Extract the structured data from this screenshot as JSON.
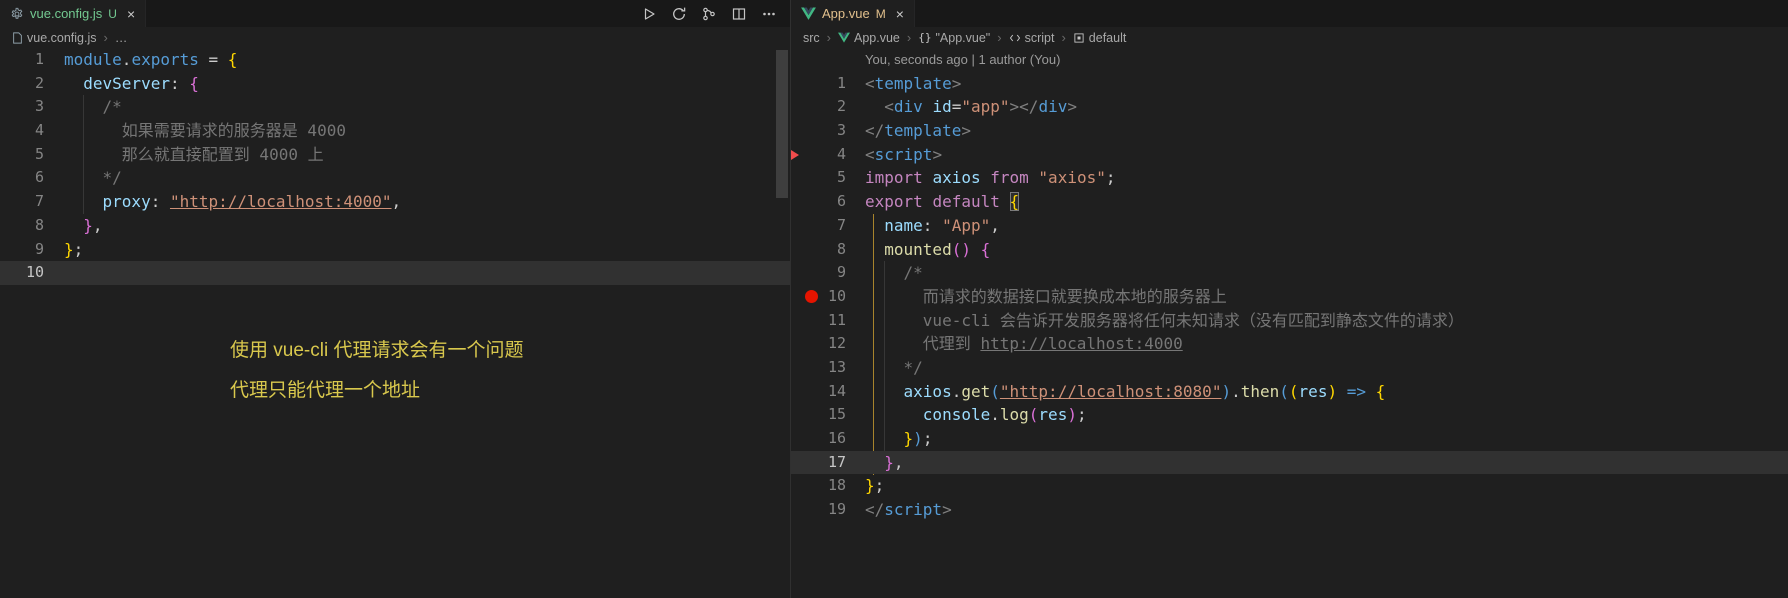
{
  "colors": {
    "editor_bg": "#1f1f1f",
    "tabbar_bg": "#181818",
    "untracked_green": "#73c991",
    "modified_yellow": "#e2c08d",
    "breakpoint_red": "#e51400",
    "annotation_yellow": "#d9c84d",
    "bracket_guide_gold": "#a8842c",
    "string_orange": "#ce9178",
    "keyword_blue": "#569cd6",
    "keyword_pink": "#c586c0"
  },
  "left_pane": {
    "tab": {
      "label": "vue.config.js",
      "git_badge": "U",
      "close_label": "×"
    },
    "toolbar": {
      "icons": [
        "run",
        "refresh",
        "source-control-graph",
        "split-editor",
        "more-actions"
      ]
    },
    "breadcrumb": {
      "sep": "›",
      "items": [
        "vue.config.js",
        "…"
      ]
    },
    "annotations": [
      "使用 vue-cli 代理请求会有一个问题",
      "代理只能代理一个地址"
    ],
    "code": [
      {
        "n": "1",
        "t": [
          [
            "module",
            "c-blue"
          ],
          [
            ".",
            "c-pun"
          ],
          [
            "exports",
            "c-blue"
          ],
          [
            " = ",
            "c-pun"
          ],
          [
            "{",
            "c-gold"
          ]
        ]
      },
      {
        "n": "2",
        "t": [
          [
            "  ",
            "c-pun"
          ],
          [
            "devServer",
            "c-lblue"
          ],
          [
            ": ",
            "c-pun"
          ],
          [
            "{",
            "c-purp"
          ]
        ]
      },
      {
        "n": "3",
        "t": [
          [
            "    /*",
            "c-cmt"
          ]
        ]
      },
      {
        "n": "4",
        "t": [
          [
            "      如果需要请求的服务器是 4000",
            "c-cmt"
          ]
        ]
      },
      {
        "n": "5",
        "t": [
          [
            "      那么就直接配置到 4000 上",
            "c-cmt"
          ]
        ]
      },
      {
        "n": "6",
        "t": [
          [
            "    */",
            "c-cmt"
          ]
        ]
      },
      {
        "n": "7",
        "t": [
          [
            "    ",
            "c-pun"
          ],
          [
            "proxy",
            "c-lblue"
          ],
          [
            ": ",
            "c-pun"
          ],
          [
            "\"http://localhost:4000\"",
            "c-str u"
          ],
          [
            ",",
            "c-pun"
          ]
        ]
      },
      {
        "n": "8",
        "t": [
          [
            "  ",
            "c-pun"
          ],
          [
            "}",
            "c-purp"
          ],
          [
            ",",
            "c-pun"
          ]
        ]
      },
      {
        "n": "9",
        "t": [
          [
            "}",
            "c-gold"
          ],
          [
            ";",
            "c-pun"
          ]
        ]
      },
      {
        "n": "10",
        "t": [],
        "hl": true
      }
    ]
  },
  "right_pane": {
    "tab": {
      "label": "App.vue",
      "git_badge": "M",
      "close_label": "×"
    },
    "breadcrumb": {
      "sep": "›",
      "braces": "{}",
      "items": [
        "src",
        "App.vue",
        "\"App.vue\"",
        "script",
        "default"
      ]
    },
    "codelens": "You, seconds ago | 1 author (You)",
    "code": [
      {
        "n": "1",
        "t": [
          [
            "<",
            "c-ang"
          ],
          [
            "template",
            "c-blue"
          ],
          [
            ">",
            "c-ang"
          ]
        ]
      },
      {
        "n": "2",
        "t": [
          [
            "  ",
            "c-pun"
          ],
          [
            "<",
            "c-ang"
          ],
          [
            "div",
            "c-blue"
          ],
          [
            " ",
            "c-pun"
          ],
          [
            "id",
            "c-lblue"
          ],
          [
            "=",
            "c-pun"
          ],
          [
            "\"app\"",
            "c-str"
          ],
          [
            ">",
            "c-ang"
          ],
          [
            "</",
            "c-ang"
          ],
          [
            "div",
            "c-blue"
          ],
          [
            ">",
            "c-ang"
          ]
        ]
      },
      {
        "n": "3",
        "t": [
          [
            "</",
            "c-ang"
          ],
          [
            "template",
            "c-blue"
          ],
          [
            ">",
            "c-ang"
          ]
        ]
      },
      {
        "n": "4",
        "t": [
          [
            "<",
            "c-ang"
          ],
          [
            "script",
            "c-blue"
          ],
          [
            ">",
            "c-ang"
          ]
        ],
        "mk": true
      },
      {
        "n": "5",
        "t": [
          [
            "import",
            "c-pink"
          ],
          [
            " ",
            "c-pun"
          ],
          [
            "axios",
            "c-lblue"
          ],
          [
            " ",
            "c-pun"
          ],
          [
            "from",
            "c-pink"
          ],
          [
            " ",
            "c-pun"
          ],
          [
            "\"axios\"",
            "c-str"
          ],
          [
            ";",
            "c-pun"
          ]
        ]
      },
      {
        "n": "6",
        "t": [
          [
            "export",
            "c-pink"
          ],
          [
            " ",
            "c-pun"
          ],
          [
            "default",
            "c-pink"
          ],
          [
            " ",
            "c-pun"
          ],
          [
            "{",
            "c-gold match"
          ]
        ]
      },
      {
        "n": "7",
        "t": [
          [
            "  ",
            "c-pun"
          ],
          [
            "name",
            "c-lblue"
          ],
          [
            ": ",
            "c-pun"
          ],
          [
            "\"App\"",
            "c-str"
          ],
          [
            ",",
            "c-pun"
          ]
        ]
      },
      {
        "n": "8",
        "t": [
          [
            "  ",
            "c-pun"
          ],
          [
            "mounted",
            "c-fn"
          ],
          [
            "()",
            "c-purp"
          ],
          [
            " ",
            "c-pun"
          ],
          [
            "{",
            "c-purp"
          ]
        ]
      },
      {
        "n": "9",
        "t": [
          [
            "    /*",
            "c-cmt"
          ]
        ]
      },
      {
        "n": "10",
        "t": [
          [
            "      而请求的数据接口就要换成本地的服务器上",
            "c-cmt"
          ]
        ],
        "bp": true
      },
      {
        "n": "11",
        "t": [
          [
            "      vue-cli 会告诉开发服务器将任何未知请求（没有匹配到静态文件的请求）",
            "c-cmt"
          ]
        ]
      },
      {
        "n": "12",
        "t": [
          [
            "      代理到 ",
            "c-cmt"
          ],
          [
            "http://localhost:4000",
            "c-cmt u"
          ]
        ]
      },
      {
        "n": "13",
        "t": [
          [
            "    */",
            "c-cmt"
          ]
        ]
      },
      {
        "n": "14",
        "t": [
          [
            "    ",
            "c-pun"
          ],
          [
            "axios",
            "c-lblue"
          ],
          [
            ".",
            "c-pun"
          ],
          [
            "get",
            "c-fn"
          ],
          [
            "(",
            "c-blue"
          ],
          [
            "\"http://localhost:8080\"",
            "c-str u"
          ],
          [
            ")",
            "c-blue"
          ],
          [
            ".",
            "c-pun"
          ],
          [
            "then",
            "c-fn"
          ],
          [
            "(",
            "c-blue"
          ],
          [
            "(",
            "c-gold"
          ],
          [
            "res",
            "c-lblue"
          ],
          [
            ")",
            "c-gold"
          ],
          [
            " ",
            "c-pun"
          ],
          [
            "=>",
            "c-blue"
          ],
          [
            " ",
            "c-pun"
          ],
          [
            "{",
            "c-gold"
          ]
        ]
      },
      {
        "n": "15",
        "t": [
          [
            "      ",
            "c-pun"
          ],
          [
            "console",
            "c-lblue"
          ],
          [
            ".",
            "c-pun"
          ],
          [
            "log",
            "c-fn"
          ],
          [
            "(",
            "c-purp"
          ],
          [
            "res",
            "c-lblue"
          ],
          [
            ")",
            "c-purp"
          ],
          [
            ";",
            "c-pun"
          ]
        ]
      },
      {
        "n": "16",
        "t": [
          [
            "    ",
            "c-pun"
          ],
          [
            "}",
            "c-gold"
          ],
          [
            ")",
            "c-blue"
          ],
          [
            ";",
            "c-pun"
          ]
        ]
      },
      {
        "n": "17",
        "t": [
          [
            "  ",
            "c-pun"
          ],
          [
            "}",
            "c-purp"
          ],
          [
            ",",
            "c-pun"
          ]
        ],
        "hl": true
      },
      {
        "n": "18",
        "t": [
          [
            "}",
            "c-gold"
          ],
          [
            ";",
            "c-pun"
          ]
        ]
      },
      {
        "n": "19",
        "t": [
          [
            "</",
            "c-ang"
          ],
          [
            "script",
            "c-blue"
          ],
          [
            ">",
            "c-ang"
          ]
        ]
      }
    ]
  }
}
